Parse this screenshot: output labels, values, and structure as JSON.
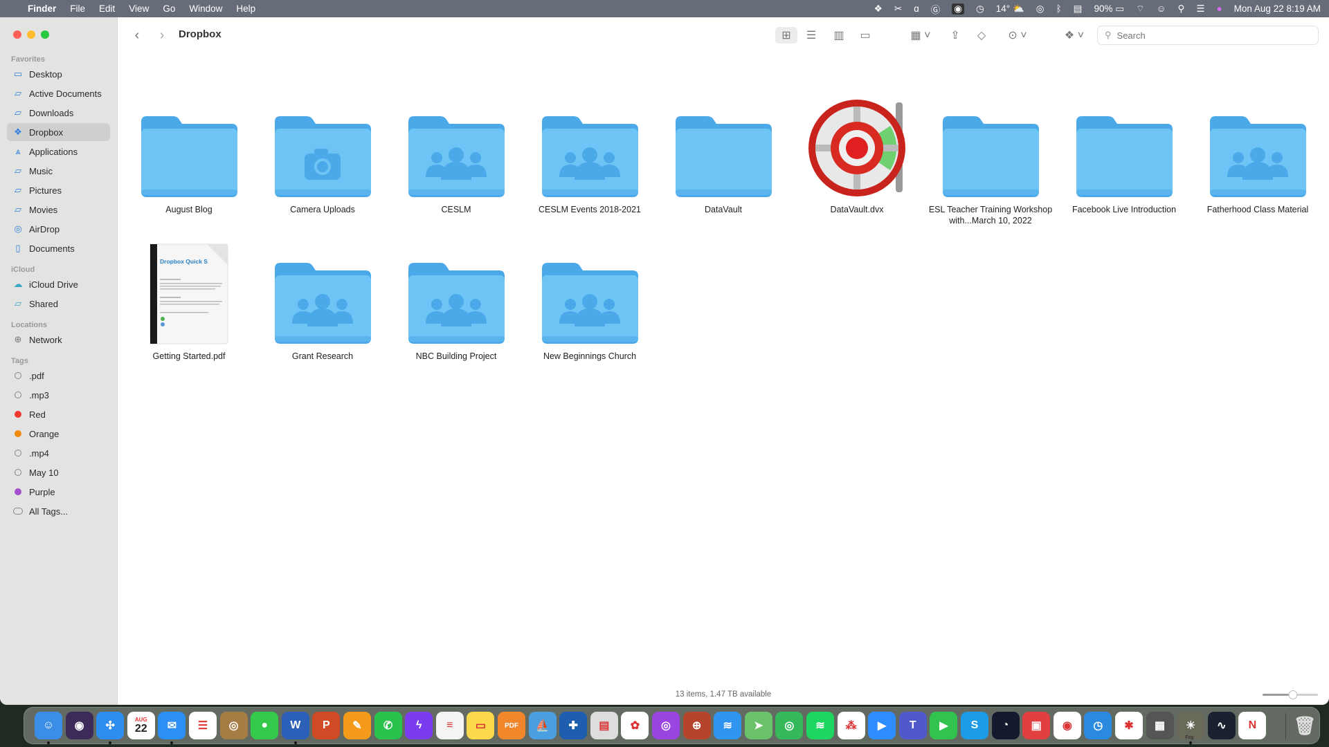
{
  "menubar": {
    "apple": "",
    "app": "Finder",
    "menus": [
      "File",
      "Edit",
      "View",
      "Go",
      "Window",
      "Help"
    ],
    "status": {
      "temperature": "14°",
      "battery": "90%",
      "clock": "Mon Aug 22  8:19 AM"
    },
    "status_icons": [
      "dropbox-icon",
      "scissors-icon",
      "signature-icon",
      "grammarly-icon",
      "camera-icon",
      "time-machine-icon",
      "weather-icon",
      "airdrop-icon",
      "bluetooth-icon",
      "display-icon",
      "battery-icon",
      "wifi-icon",
      "user-icon",
      "spotlight-icon",
      "control-center-icon",
      "siri-icon"
    ]
  },
  "window": {
    "title": "Dropbox",
    "search_placeholder": "Search",
    "status": "13 items, 1.47 TB available",
    "icon_size_fraction": 0.5
  },
  "sidebar": {
    "sections": [
      {
        "title": "Favorites",
        "items": [
          {
            "label": "Desktop",
            "icon": "desktop-icon"
          },
          {
            "label": "Active Documents",
            "icon": "folder-icon"
          },
          {
            "label": "Downloads",
            "icon": "folder-icon"
          },
          {
            "label": "Dropbox",
            "icon": "dropbox-icon",
            "selected": true
          },
          {
            "label": "Applications",
            "icon": "applications-icon"
          },
          {
            "label": "Music",
            "icon": "folder-icon"
          },
          {
            "label": "Pictures",
            "icon": "folder-icon"
          },
          {
            "label": "Movies",
            "icon": "folder-icon"
          },
          {
            "label": "AirDrop",
            "icon": "airdrop-icon"
          },
          {
            "label": "Documents",
            "icon": "document-icon"
          }
        ]
      },
      {
        "title": "iCloud",
        "items": [
          {
            "label": "iCloud Drive",
            "icon": "cloud-icon"
          },
          {
            "label": "Shared",
            "icon": "shared-folder-icon"
          }
        ]
      },
      {
        "title": "Locations",
        "items": [
          {
            "label": "Network",
            "icon": "network-icon"
          }
        ]
      },
      {
        "title": "Tags",
        "items": [
          {
            "label": ".pdf",
            "tag": "#ffffff"
          },
          {
            "label": ".mp3",
            "tag": "#ffffff"
          },
          {
            "label": "Red",
            "tag": "#f03a30"
          },
          {
            "label": "Orange",
            "tag": "#f08a0a"
          },
          {
            "label": ".mp4",
            "tag": "#ffffff"
          },
          {
            "label": "May 10",
            "tag": "#ffffff"
          },
          {
            "label": "Purple",
            "tag": "#a24fd0"
          },
          {
            "label": "All Tags...",
            "tag": "all"
          }
        ]
      }
    ]
  },
  "files": [
    {
      "name": "August Blog",
      "type": "folder"
    },
    {
      "name": "Camera Uploads",
      "type": "camera"
    },
    {
      "name": "CESLM",
      "type": "shared"
    },
    {
      "name": "CESLM Events 2018-2021",
      "type": "shared"
    },
    {
      "name": "DataVault",
      "type": "folder"
    },
    {
      "name": "DataVault.dvx",
      "type": "dvx"
    },
    {
      "name": "ESL Teacher Training Workshop with...March 10, 2022",
      "type": "folder"
    },
    {
      "name": "Facebook Live Introduction",
      "type": "folder"
    },
    {
      "name": "Fatherhood Class Material",
      "type": "shared"
    },
    {
      "name": "Getting Started.pdf",
      "type": "pdf",
      "thumb_title": "Dropbox Quick S"
    },
    {
      "name": "Grant Research",
      "type": "shared"
    },
    {
      "name": "NBC Building Project",
      "type": "shared"
    },
    {
      "name": "New Beginnings Church",
      "type": "shared"
    }
  ],
  "dock": {
    "apps": [
      {
        "name": "Finder",
        "color": "#3a8ee6",
        "glyph": "☺",
        "running": true
      },
      {
        "name": "Siri",
        "color": "#3b2a5a",
        "glyph": "◉"
      },
      {
        "name": "Safari",
        "color": "#2e8ef0",
        "glyph": "✣",
        "running": true
      },
      {
        "name": "Calendar",
        "color": "#ffffff",
        "glyph": "22",
        "label": "AUG"
      },
      {
        "name": "Mail",
        "color": "#2b8ff5",
        "glyph": "✉",
        "running": true
      },
      {
        "name": "Reminders",
        "color": "#ffffff",
        "glyph": "☰"
      },
      {
        "name": "Contacts",
        "color": "#a67c45",
        "glyph": "◎"
      },
      {
        "name": "Messages",
        "color": "#34c94a",
        "glyph": "●"
      },
      {
        "name": "Microsoft Word",
        "color": "#2b5fb8",
        "glyph": "W",
        "running": true
      },
      {
        "name": "Microsoft PowerPoint",
        "color": "#d04a26",
        "glyph": "P"
      },
      {
        "name": "Pages",
        "color": "#f59a1b",
        "glyph": "✎"
      },
      {
        "name": "WhatsApp",
        "color": "#28c24c",
        "glyph": "✆"
      },
      {
        "name": "Messenger",
        "color": "#7b3cf0",
        "glyph": "ϟ"
      },
      {
        "name": "TextEdit",
        "color": "#f4f4f4",
        "glyph": "≡"
      },
      {
        "name": "Notes",
        "color": "#fcd94a",
        "glyph": "▭"
      },
      {
        "name": "PDF Expert",
        "color": "#f2862a",
        "glyph": "PDF"
      },
      {
        "name": "Preview",
        "color": "#4a9fe0",
        "glyph": "⛵"
      },
      {
        "name": "Bible Search",
        "color": "#1d5fae",
        "glyph": "✚"
      },
      {
        "name": "Printer",
        "color": "#dddddd",
        "glyph": "▤"
      },
      {
        "name": "Photos",
        "color": "#ffffff",
        "glyph": "✿"
      },
      {
        "name": "Podcasts",
        "color": "#9a45e0",
        "glyph": "◎"
      },
      {
        "name": "DataVault",
        "color": "#b5452a",
        "glyph": "⊕"
      },
      {
        "name": "WiFi Explorer",
        "color": "#2f95f0",
        "glyph": "≋"
      },
      {
        "name": "Maps",
        "color": "#6ac26a",
        "glyph": "➤"
      },
      {
        "name": "Find My",
        "color": "#34b85a",
        "glyph": "◎"
      },
      {
        "name": "Spotify",
        "color": "#1ed760",
        "glyph": "≋"
      },
      {
        "name": "Asana",
        "color": "#ffffff",
        "glyph": "⁂"
      },
      {
        "name": "Zoom",
        "color": "#2d8cff",
        "glyph": "▶"
      },
      {
        "name": "Microsoft Teams",
        "color": "#5059c9",
        "glyph": "T"
      },
      {
        "name": "FaceTime",
        "color": "#32c34e",
        "glyph": "▶"
      },
      {
        "name": "Skype",
        "color": "#1d9be6",
        "glyph": "S"
      },
      {
        "name": "Speedtest",
        "color": "#141a2e",
        "glyph": "◔"
      },
      {
        "name": "Radio",
        "color": "#e04040",
        "glyph": "▣"
      },
      {
        "name": "Google Chrome",
        "color": "#ffffff",
        "glyph": "◉"
      },
      {
        "name": "Clock",
        "color": "#2a8ae0",
        "glyph": "◷"
      },
      {
        "name": "Weather Bug",
        "color": "#ffffff",
        "glyph": "✱"
      },
      {
        "name": "Calculator",
        "color": "#555555",
        "glyph": "▦"
      },
      {
        "name": "Fog",
        "color": "#6a6a5a",
        "glyph": "☀",
        "running": true,
        "label": "Fog"
      },
      {
        "name": "Stocks",
        "color": "#1a2230",
        "glyph": "∿"
      },
      {
        "name": "News",
        "color": "#ffffff",
        "glyph": "N"
      }
    ],
    "trash": "Trash"
  },
  "colors": {
    "folder": "#6ec5f5",
    "folder_tab": "#4ba9ea",
    "accent": "#2d7fe0",
    "menubar": "#666c78",
    "sidebar": "#e3e3e2"
  }
}
